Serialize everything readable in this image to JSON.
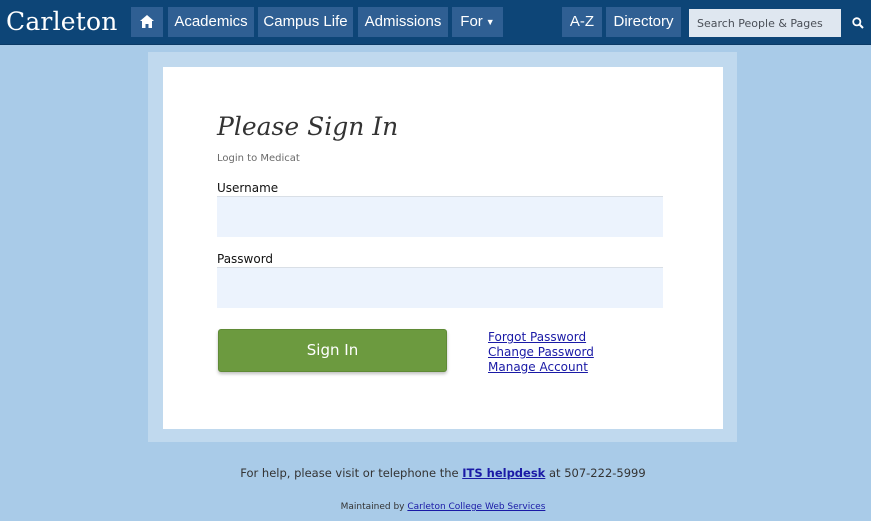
{
  "header": {
    "brand": "Carleton",
    "nav": {
      "academics": "Academics",
      "campus_life": "Campus Life",
      "admissions": "Admissions",
      "for": "For",
      "az": "A-Z",
      "directory": "Directory"
    },
    "search": {
      "placeholder": "Search People & Pages"
    },
    "icons": {
      "home": "home-icon",
      "search": "search-icon",
      "for_caret": "caret-down-icon"
    }
  },
  "login": {
    "title": "Please Sign In",
    "subtitle": "Login to Medicat",
    "username_label": "Username",
    "username_value": "",
    "password_label": "Password",
    "password_value": "",
    "submit_label": "Sign In",
    "links": {
      "forgot": "Forgot Password",
      "change": "Change Password",
      "manage": "Manage Account"
    }
  },
  "footer": {
    "help_prefix": "For help, please visit or telephone the",
    "help_link": "ITS helpdesk",
    "help_suffix": "at 507-222-5999",
    "maint_prefix": "Maintained by",
    "maint_link": "Carleton College Web Services"
  },
  "colors": {
    "nav_bar": "#0d4577",
    "nav_button": "#2f5f93",
    "page_background": "#a9cbe8",
    "signin_button": "#6c9a3f",
    "link": "#1a1aa6"
  }
}
